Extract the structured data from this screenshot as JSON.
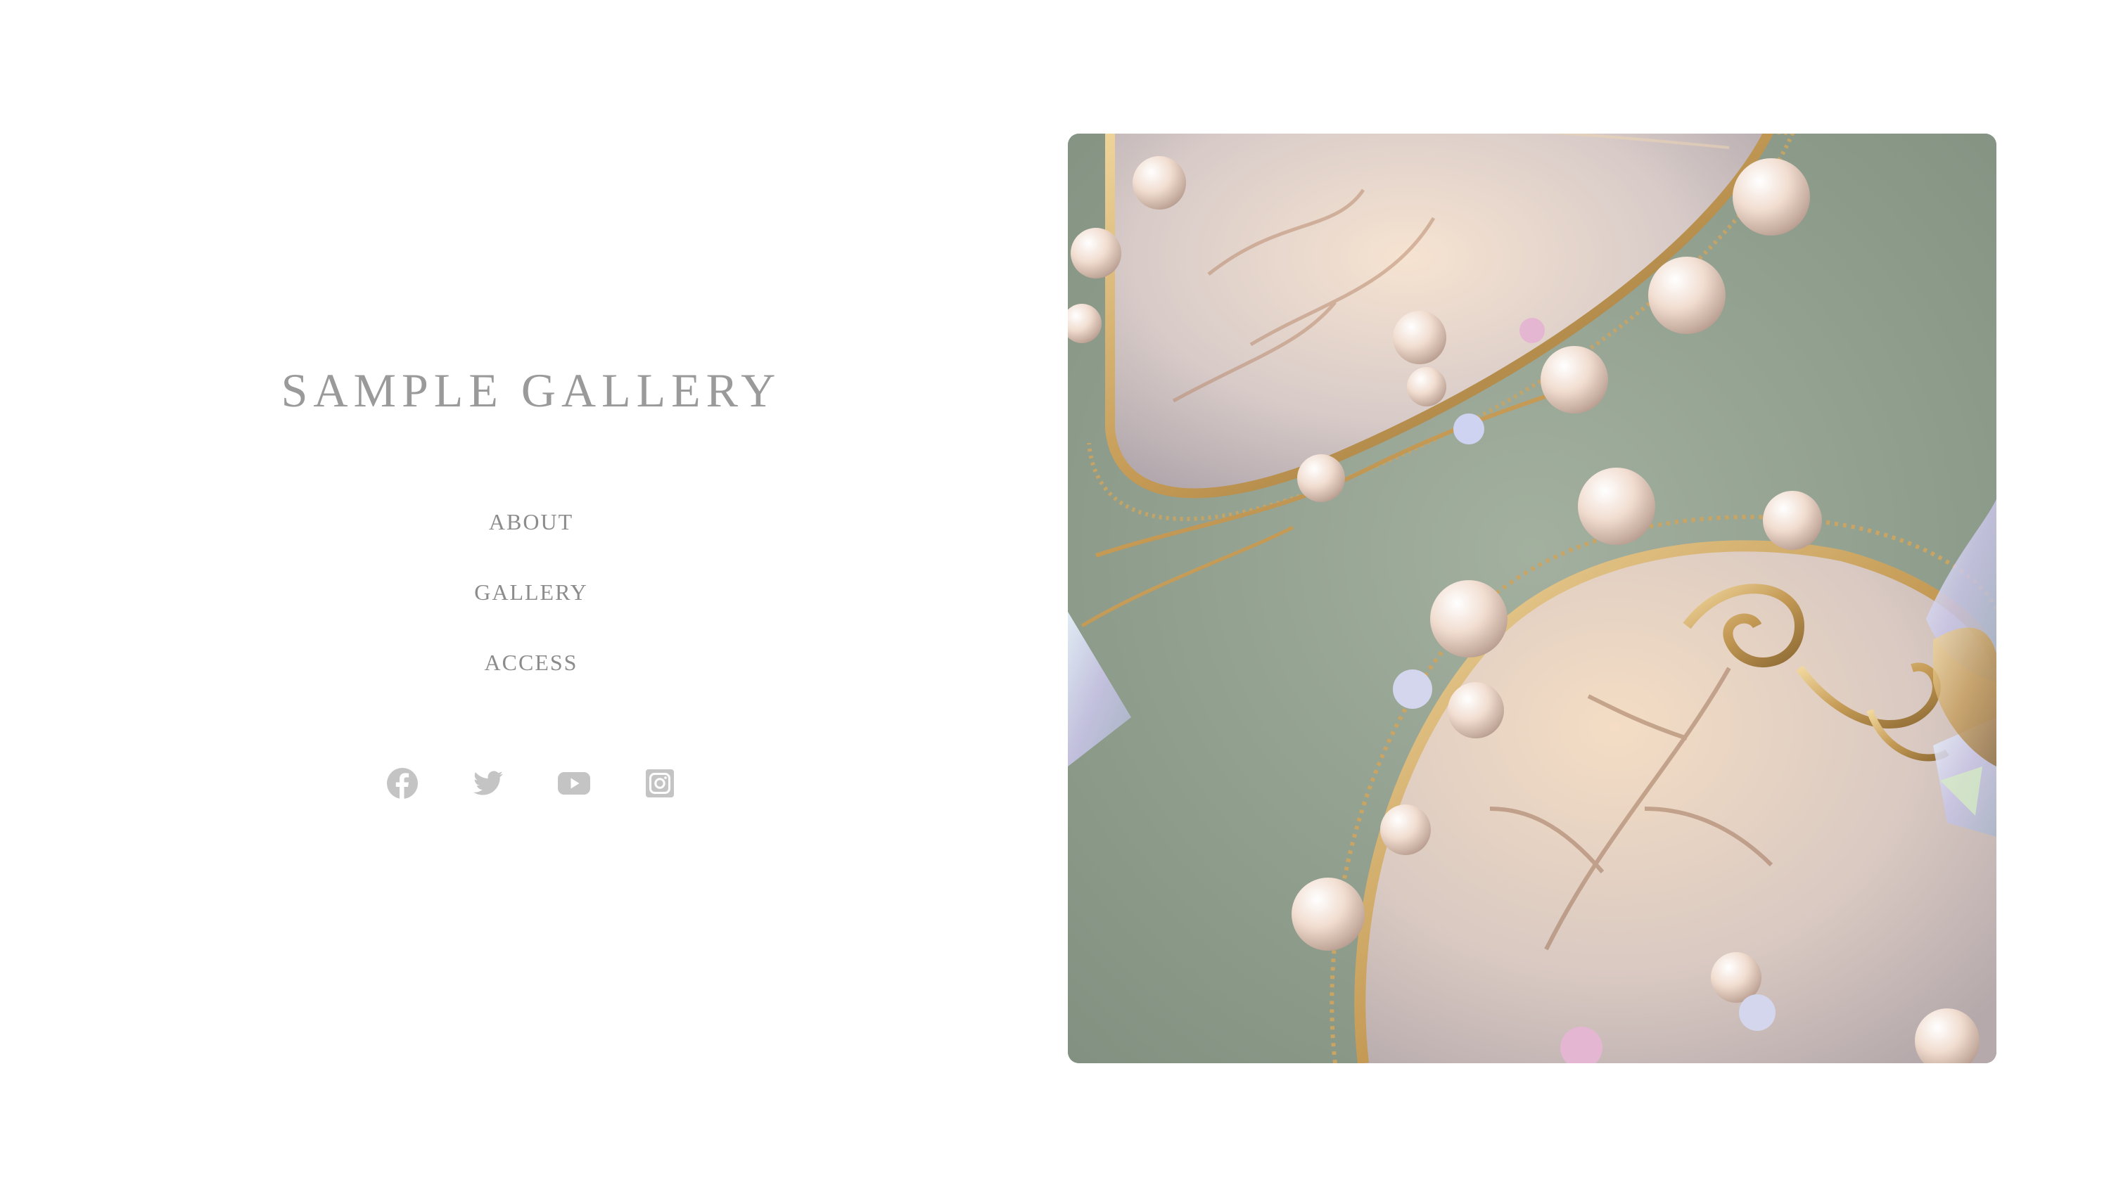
{
  "site": {
    "title": "SAMPLE GALLERY"
  },
  "nav": {
    "items": [
      {
        "label": "ABOUT"
      },
      {
        "label": "GALLERY"
      },
      {
        "label": "ACCESS"
      }
    ]
  },
  "social": {
    "icons": [
      "facebook-icon",
      "twitter-icon",
      "youtube-icon",
      "instagram-icon"
    ],
    "color": "#c4c4c4"
  },
  "hero": {
    "subject": "pearl and gold filigree heart-shaped jewelry",
    "background_color": "#8f9e8d"
  }
}
